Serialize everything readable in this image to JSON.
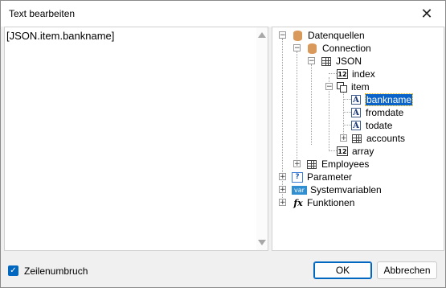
{
  "window": {
    "title": "Text bearbeiten"
  },
  "editor": {
    "text": "[JSON.item.bankname]"
  },
  "tree": {
    "datasources": "Datenquellen",
    "connection": "Connection",
    "json": "JSON",
    "index": "index",
    "item": "item",
    "bankname": "bankname",
    "fromdate": "fromdate",
    "todate": "todate",
    "accounts": "accounts",
    "array": "array",
    "employees": "Employees",
    "parameter": "Parameter",
    "systemvars": "Systemvariablen",
    "functions": "Funktionen",
    "num_icon_text": "12",
    "A_icon_text": "A",
    "param_icon_text": "?",
    "var_icon_text": "var",
    "fx_icon_text": "fx"
  },
  "footer": {
    "wordwrap_label": "Zeilenumbruch",
    "wordwrap_checked": true,
    "ok_label": "OK",
    "cancel_label": "Abbrechen"
  },
  "colors": {
    "selection": "#0a63c9",
    "accent": "#0067c0"
  }
}
